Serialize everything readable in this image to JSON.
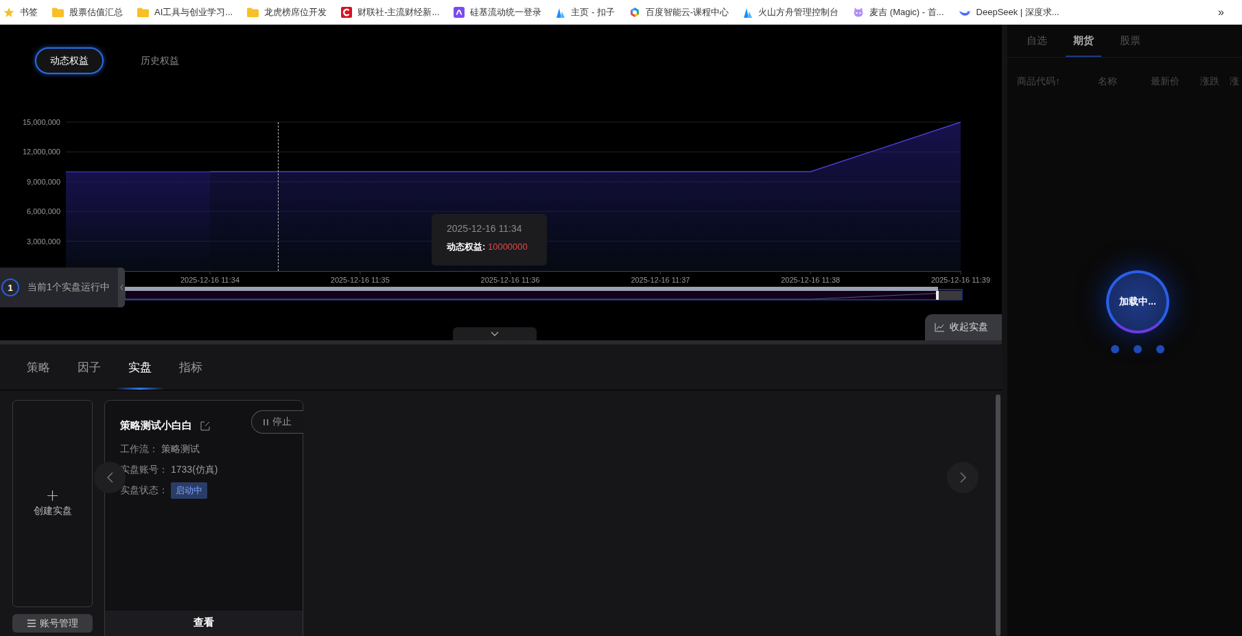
{
  "bookmarks_bar": {
    "items": [
      {
        "label": "书签"
      },
      {
        "label": "股票估值汇总"
      },
      {
        "label": "AI工具与创业学习..."
      },
      {
        "label": "龙虎榜席位开发"
      },
      {
        "label": "财联社-主流财经新..."
      },
      {
        "label": "硅基流动统一登录"
      },
      {
        "label": "主页 - 扣子"
      },
      {
        "label": "百度智能云-课程中心"
      },
      {
        "label": "火山方舟管理控制台"
      },
      {
        "label": "麦吉 (Magic) - 首..."
      },
      {
        "label": "DeepSeek | 深度求..."
      }
    ],
    "overflow": "»"
  },
  "equity": {
    "tabs": [
      {
        "label": "动态权益",
        "selected": true
      },
      {
        "label": "历史权益",
        "selected": false
      }
    ],
    "chart_data": {
      "type": "area",
      "categories": [
        "2025-12-16 11:34",
        "2025-12-16 11:35",
        "2025-12-16 11:36",
        "2025-12-16 11:37",
        "2025-12-16 11:38",
        "2025-12-16 11:39"
      ],
      "series": [
        {
          "color": "#4a3fd6",
          "values": [
            10000000,
            10000000,
            10000000,
            10000000,
            10000000,
            15000000
          ]
        }
      ],
      "ylim": [
        0,
        15000000
      ],
      "grid": true,
      "yticks": [
        {
          "value": 3000000,
          "label": "3,000,000"
        },
        {
          "value": 6000000,
          "label": "6,000,000"
        },
        {
          "value": 9000000,
          "label": "9,000,000"
        },
        {
          "value": 12000000,
          "label": "12,000,000"
        },
        {
          "value": 15000000,
          "label": "15,000,000"
        }
      ]
    },
    "tooltip": {
      "time": "2025-12-16 11:34",
      "label": "动态权益:",
      "value": "10000000"
    },
    "running": {
      "count": "1",
      "text": "当前1个实盘运行中"
    },
    "collapse_button": "收起实盘"
  },
  "live": {
    "tabs": [
      {
        "label": "策略",
        "selected": false
      },
      {
        "label": "因子",
        "selected": false
      },
      {
        "label": "实盘",
        "selected": true
      },
      {
        "label": "指标",
        "selected": false
      }
    ],
    "create_card": "创建实盘",
    "account_button": "账号管理",
    "strategy_cards": [
      {
        "name": "策略测试小白白",
        "stop_button": "停止",
        "view_button": "查看",
        "fields": [
          {
            "label": "工作流：",
            "value": "策略测试"
          },
          {
            "label": "实盘账号：",
            "value": "1733(仿真)"
          },
          {
            "label": "实盘状态：",
            "badge": "启动中"
          }
        ]
      }
    ]
  },
  "market": {
    "tabs": [
      {
        "label": "自选",
        "selected": false
      },
      {
        "label": "期货",
        "selected": true
      },
      {
        "label": "股票",
        "selected": false
      }
    ],
    "columns": [
      "商品代码↑",
      "名称",
      "最新价",
      "涨跌",
      "涨"
    ],
    "loading": "加载中..."
  }
}
